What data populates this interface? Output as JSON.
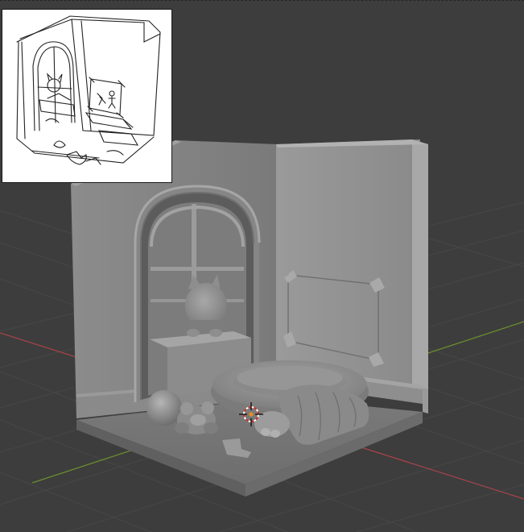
{
  "viewport": {
    "background_color": "#3d3d3d",
    "grid_color": "#4a4a4a",
    "x_axis_color": "#a8434a",
    "y_axis_color": "#6a8d2d"
  },
  "scene": {
    "object_names": [
      "room-base",
      "left-wall",
      "right-wall",
      "arched-window",
      "window-seat",
      "cat-figurine",
      "ball",
      "teddy-bear",
      "sock",
      "pet-bed",
      "blanket",
      "wall-poster",
      "3d-cursor"
    ],
    "clay_color": "#8e8e8e"
  },
  "reference_sketch": {
    "background_color": "#ffffff",
    "ink_color": "#222222"
  }
}
